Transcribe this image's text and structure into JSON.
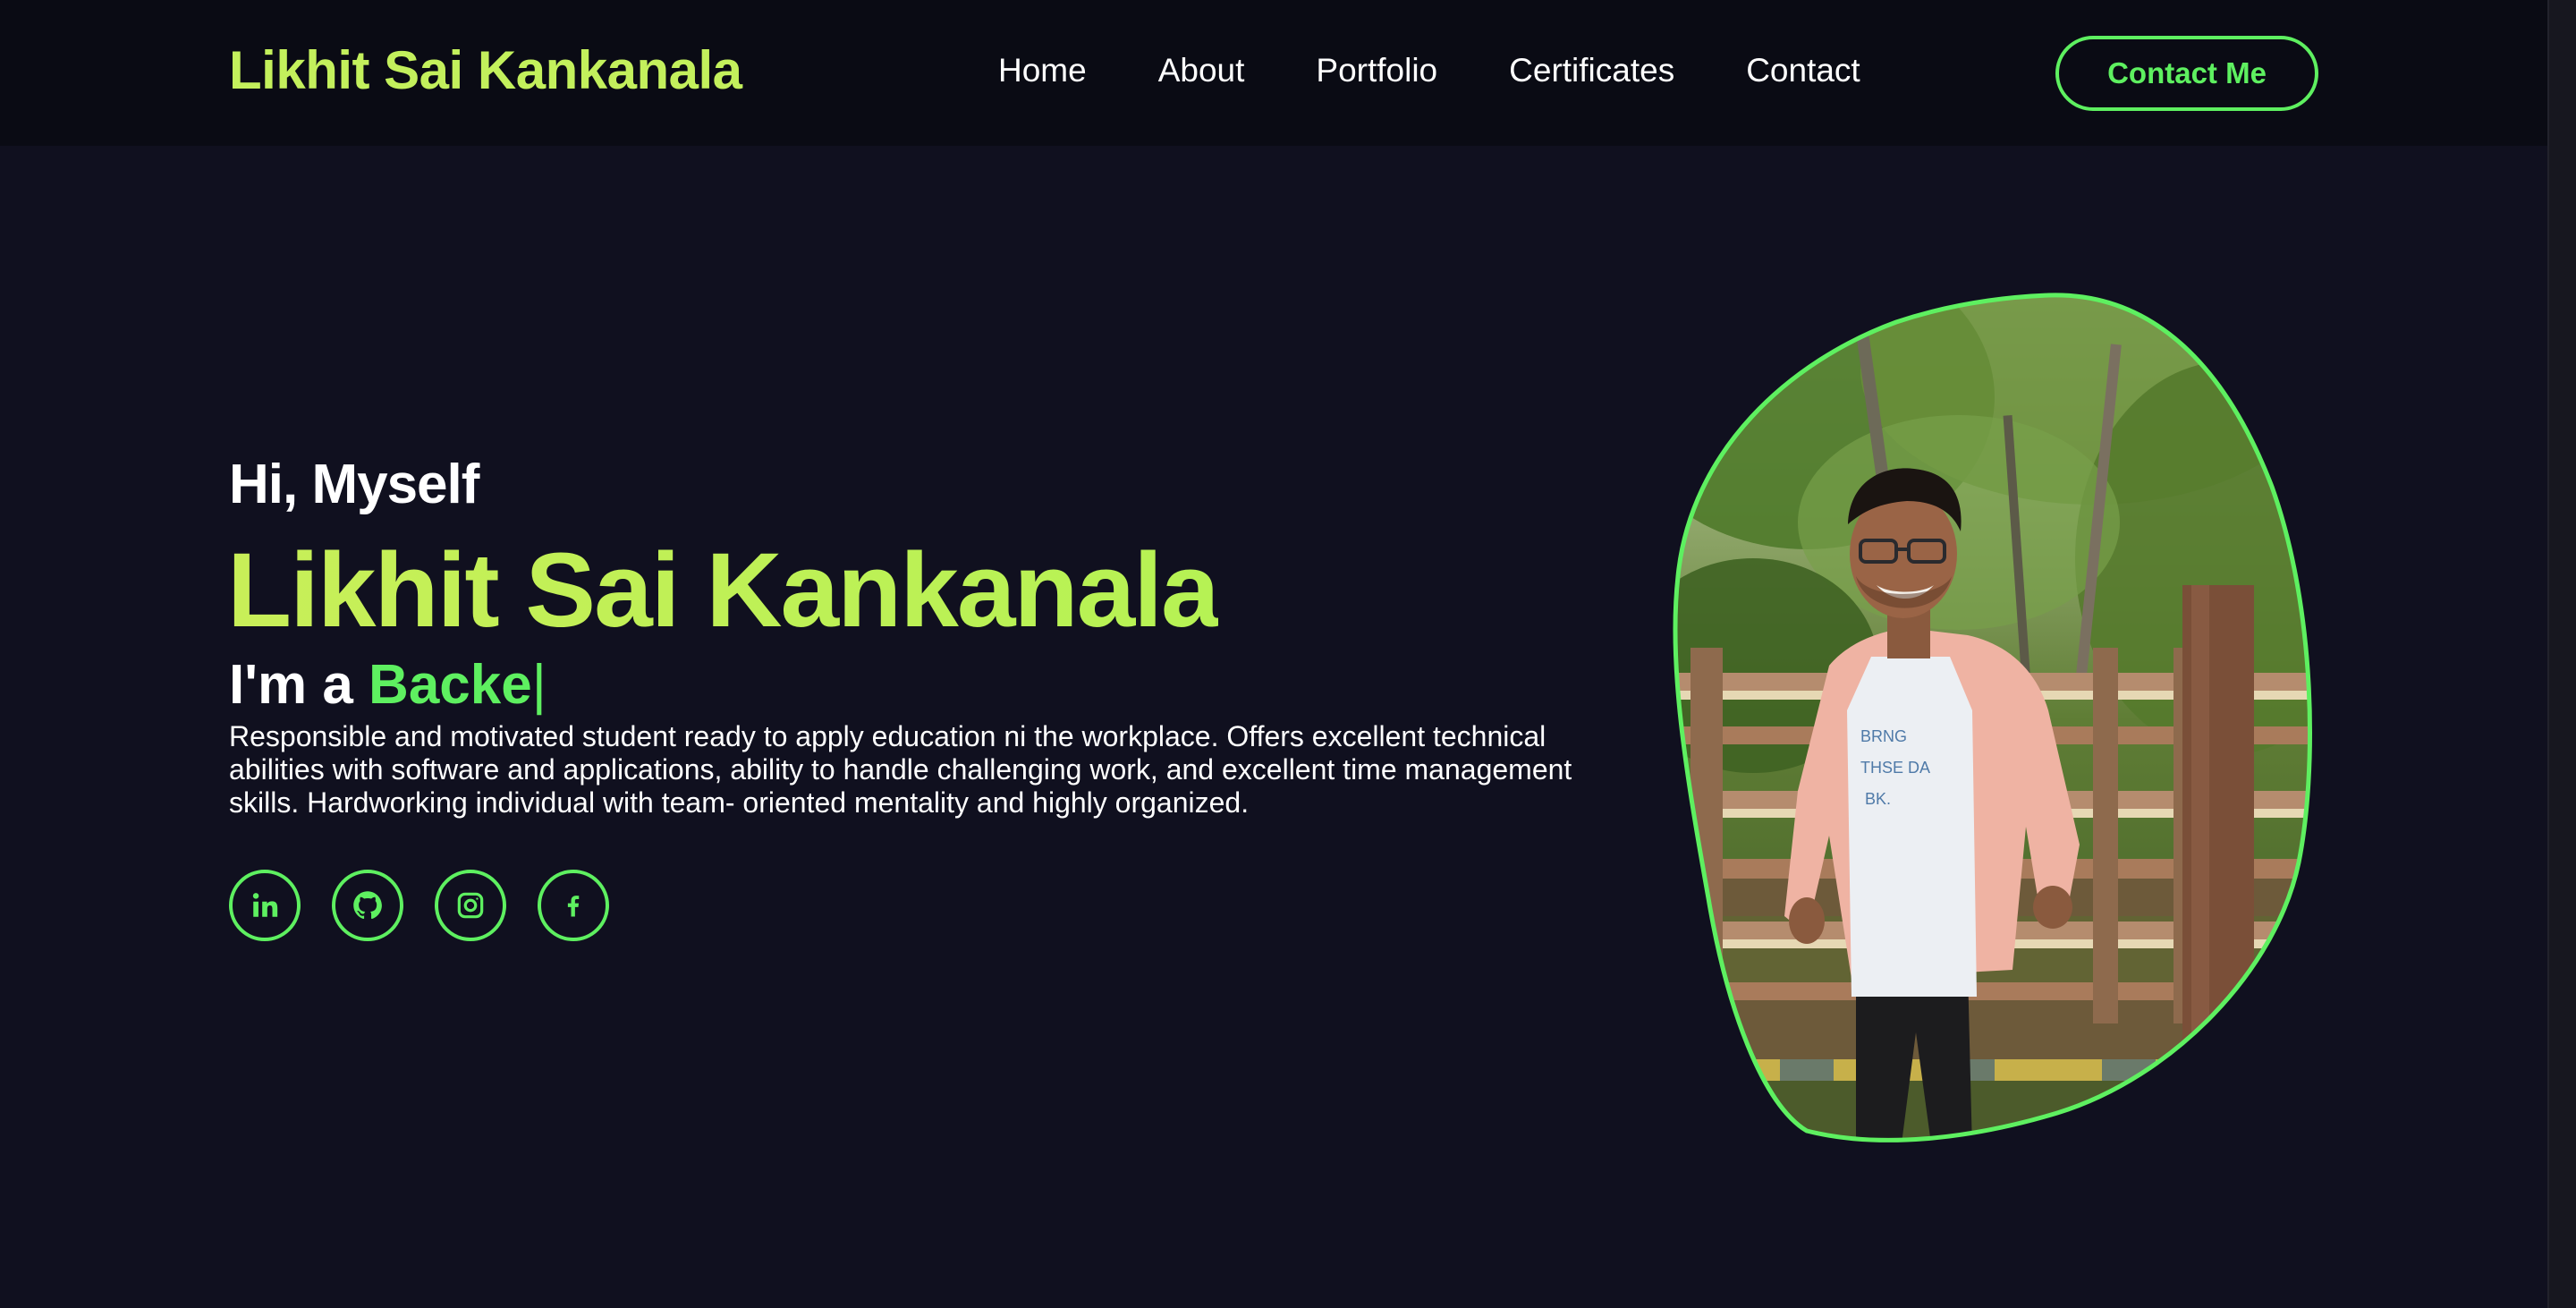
{
  "brand": {
    "name": "Likhit Sai Kankanala",
    "color": "#c3f05c"
  },
  "nav": {
    "links": [
      "Home",
      "About",
      "Portfolio",
      "Certificates",
      "Contact"
    ],
    "cta_label": "Contact Me",
    "accent": "#5ef060"
  },
  "hero": {
    "greeting": "Hi, Myself",
    "name": "Likhit Sai Kankanala",
    "role_prefix": "I'm a",
    "role_typed": "Backe",
    "caret": "|",
    "bio": "Responsible and motivated student ready to apply education ni the workplace. Offers excellent technical abilities with software and applications, ability to handle challenging work, and excellent time management skills. Hardworking individual with team- oriented mentality and highly organized."
  },
  "socials": [
    {
      "icon": "linkedin-icon"
    },
    {
      "icon": "github-icon"
    },
    {
      "icon": "instagram-icon"
    },
    {
      "icon": "facebook-icon"
    }
  ],
  "photo": {
    "alt_subject": "profile-photo",
    "shirt_text": [
      "BRNG",
      "THSE DA",
      "BK."
    ]
  },
  "colors": {
    "background": "#10101f",
    "navbar": "#0a0b14",
    "accent_green": "#5ef060",
    "name_green": "#c8ef58"
  }
}
